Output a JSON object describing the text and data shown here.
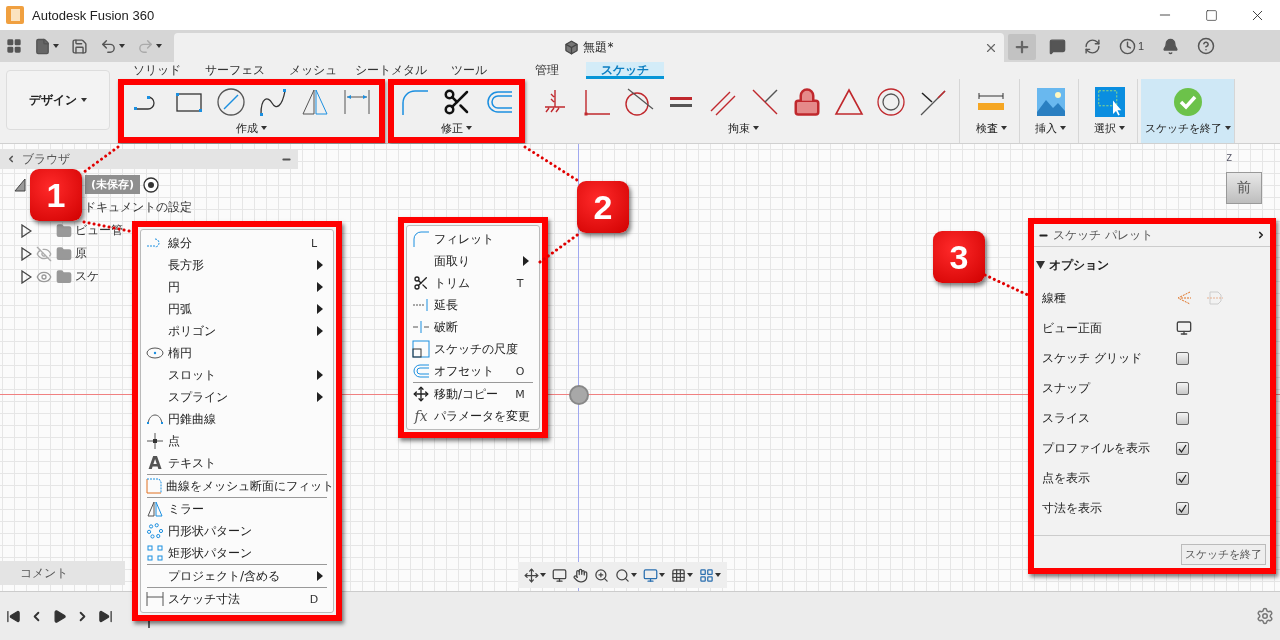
{
  "window": {
    "title": "Autodesk Fusion 360"
  },
  "document_tab": {
    "title": "無題*"
  },
  "jobs_badge": "1",
  "workspace": {
    "label": "デザイン"
  },
  "ribbon_tabs": [
    {
      "label": "ソリッド",
      "selected": false
    },
    {
      "label": "サーフェス",
      "selected": false
    },
    {
      "label": "メッシュ",
      "selected": false
    },
    {
      "label": "シートメタル",
      "selected": false
    },
    {
      "label": "ツール",
      "selected": false
    },
    {
      "label": "管理",
      "selected": false
    },
    {
      "label": "スケッチ",
      "selected": true
    }
  ],
  "tool_groups": [
    {
      "label": "作成",
      "framed": true,
      "highlighted": false
    },
    {
      "label": "修正",
      "framed": true,
      "highlighted": false
    },
    {
      "label": "拘束",
      "framed": false,
      "highlighted": false
    },
    {
      "label": "検査",
      "framed": false,
      "highlighted": false
    },
    {
      "label": "挿入",
      "framed": false,
      "highlighted": false
    },
    {
      "label": "選択",
      "framed": false,
      "highlighted": false
    },
    {
      "label": "スケッチを終了",
      "framed": false,
      "highlighted": true
    }
  ],
  "browser": {
    "title": "ブラウザ",
    "tree": [
      {
        "label": "(未保存)",
        "expanded": true,
        "children": [
          {
            "label": "ドキュメントの設定"
          },
          {
            "label": "ビュー管",
            "expanded": false
          },
          {
            "label": "原",
            "expanded": false,
            "visible": false
          },
          {
            "label": "スケ",
            "expanded": false,
            "visible": true
          }
        ]
      }
    ]
  },
  "comments": {
    "label": "コメント"
  },
  "view_cube": {
    "face": "前",
    "axis": "Z"
  },
  "create_menu": {
    "items": [
      {
        "label": "線分",
        "shortcut": "L",
        "submenu": false,
        "separator_before": false
      },
      {
        "label": "長方形",
        "submenu": true,
        "separator_before": false
      },
      {
        "label": "円",
        "submenu": true,
        "separator_before": false
      },
      {
        "label": "円弧",
        "submenu": true,
        "separator_before": false
      },
      {
        "label": "ポリゴン",
        "submenu": true,
        "separator_before": false
      },
      {
        "label": "楕円",
        "submenu": false,
        "separator_before": false
      },
      {
        "label": "スロット",
        "submenu": true,
        "separator_before": false
      },
      {
        "label": "スプライン",
        "submenu": true,
        "separator_before": false
      },
      {
        "label": "円錐曲線",
        "submenu": false,
        "separator_before": false
      },
      {
        "label": "点",
        "submenu": false,
        "separator_before": false
      },
      {
        "label": "テキスト",
        "glyph": "A",
        "submenu": false,
        "separator_before": false
      },
      {
        "label": "曲線をメッシュ断面にフィット",
        "submenu": false,
        "separator_before": true
      },
      {
        "label": "ミラー",
        "submenu": false,
        "separator_before": true
      },
      {
        "label": "円形状パターン",
        "submenu": false,
        "separator_before": false
      },
      {
        "label": "矩形状パターン",
        "submenu": false,
        "separator_before": false
      },
      {
        "label": "プロジェクト/含める",
        "submenu": true,
        "separator_before": true
      },
      {
        "label": "スケッチ寸法",
        "shortcut": "D",
        "submenu": false,
        "separator_before": true
      }
    ]
  },
  "modify_menu": {
    "items": [
      {
        "label": "フィレット",
        "submenu": false,
        "separator_before": false
      },
      {
        "label": "面取り",
        "submenu": true,
        "separator_before": false
      },
      {
        "label": "トリム",
        "shortcut": "T",
        "submenu": false,
        "separator_before": false
      },
      {
        "label": "延長",
        "submenu": false,
        "separator_before": false
      },
      {
        "label": "破断",
        "submenu": false,
        "separator_before": false
      },
      {
        "label": "スケッチの尺度",
        "submenu": false,
        "separator_before": false
      },
      {
        "label": "オフセット",
        "shortcut": "O",
        "submenu": false,
        "separator_before": false
      },
      {
        "label": "移動/コピー",
        "shortcut": "M",
        "submenu": false,
        "separator_before": true
      },
      {
        "label": "パラメータを変更",
        "glyph": "fx",
        "submenu": false,
        "separator_before": false
      }
    ]
  },
  "sketch_palette": {
    "title": "スケッチ パレット",
    "section": {
      "title": "オプション",
      "expanded": true
    },
    "rows": [
      {
        "kind": "linetype",
        "label": "線種"
      },
      {
        "kind": "lookat",
        "label": "ビュー正面"
      },
      {
        "kind": "checkbox",
        "label": "スケッチ グリッド",
        "checked": false
      },
      {
        "kind": "checkbox",
        "label": "スナップ",
        "checked": false
      },
      {
        "kind": "checkbox",
        "label": "スライス",
        "checked": false
      },
      {
        "kind": "checkbox",
        "label": "プロファイルを表示",
        "checked": true
      },
      {
        "kind": "checkbox",
        "label": "点を表示",
        "checked": true
      },
      {
        "kind": "checkbox",
        "label": "寸法を表示",
        "checked": true
      }
    ],
    "finish_button": "スケッチを終了"
  },
  "callouts": [
    "1",
    "2",
    "3"
  ]
}
